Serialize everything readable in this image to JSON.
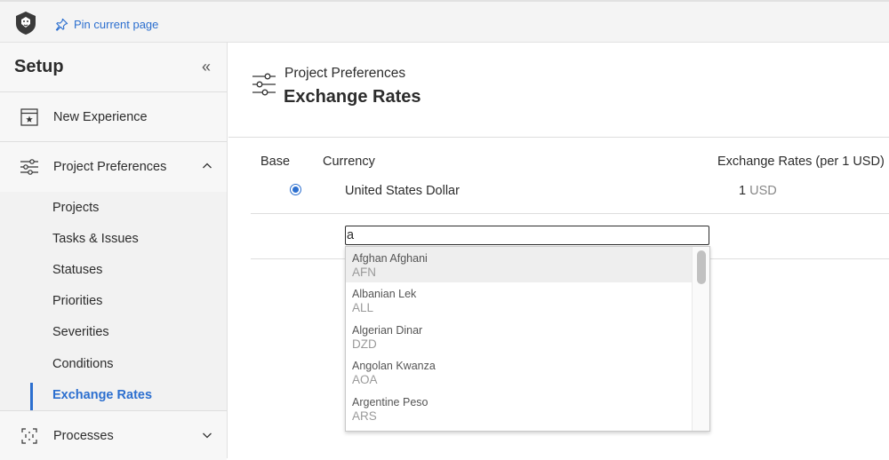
{
  "topbar": {
    "pin_label": "Pin current page"
  },
  "sidebar": {
    "title": "Setup",
    "collapse_icon": "«",
    "items": [
      {
        "label": "New Experience",
        "icon": "experience-icon"
      },
      {
        "label": "Project Preferences",
        "icon": "sliders-icon",
        "expanded": true
      }
    ],
    "subitems": [
      {
        "label": "Projects"
      },
      {
        "label": "Tasks & Issues"
      },
      {
        "label": "Statuses"
      },
      {
        "label": "Priorities"
      },
      {
        "label": "Severities"
      },
      {
        "label": "Conditions"
      },
      {
        "label": "Exchange Rates",
        "active": true
      }
    ],
    "processes": {
      "label": "Processes",
      "icon": "processes-icon"
    }
  },
  "main": {
    "breadcrumb": "Project Preferences",
    "title": "Exchange Rates",
    "columns": {
      "base": "Base",
      "currency": "Currency",
      "rates": "Exchange Rates (per 1 USD)"
    },
    "base_row": {
      "currency": "United States Dollar",
      "rate": "1",
      "unit": "USD"
    },
    "search": {
      "value": "a"
    },
    "options": [
      {
        "name": "Afghan Afghani",
        "code": "AFN"
      },
      {
        "name": "Albanian Lek",
        "code": "ALL"
      },
      {
        "name": "Algerian Dinar",
        "code": "DZD"
      },
      {
        "name": "Angolan Kwanza",
        "code": "AOA"
      },
      {
        "name": "Argentine Peso",
        "code": "ARS"
      }
    ]
  },
  "colors": {
    "accent": "#2c6fcf",
    "text": "#2c2c2c",
    "muted": "#888888"
  }
}
